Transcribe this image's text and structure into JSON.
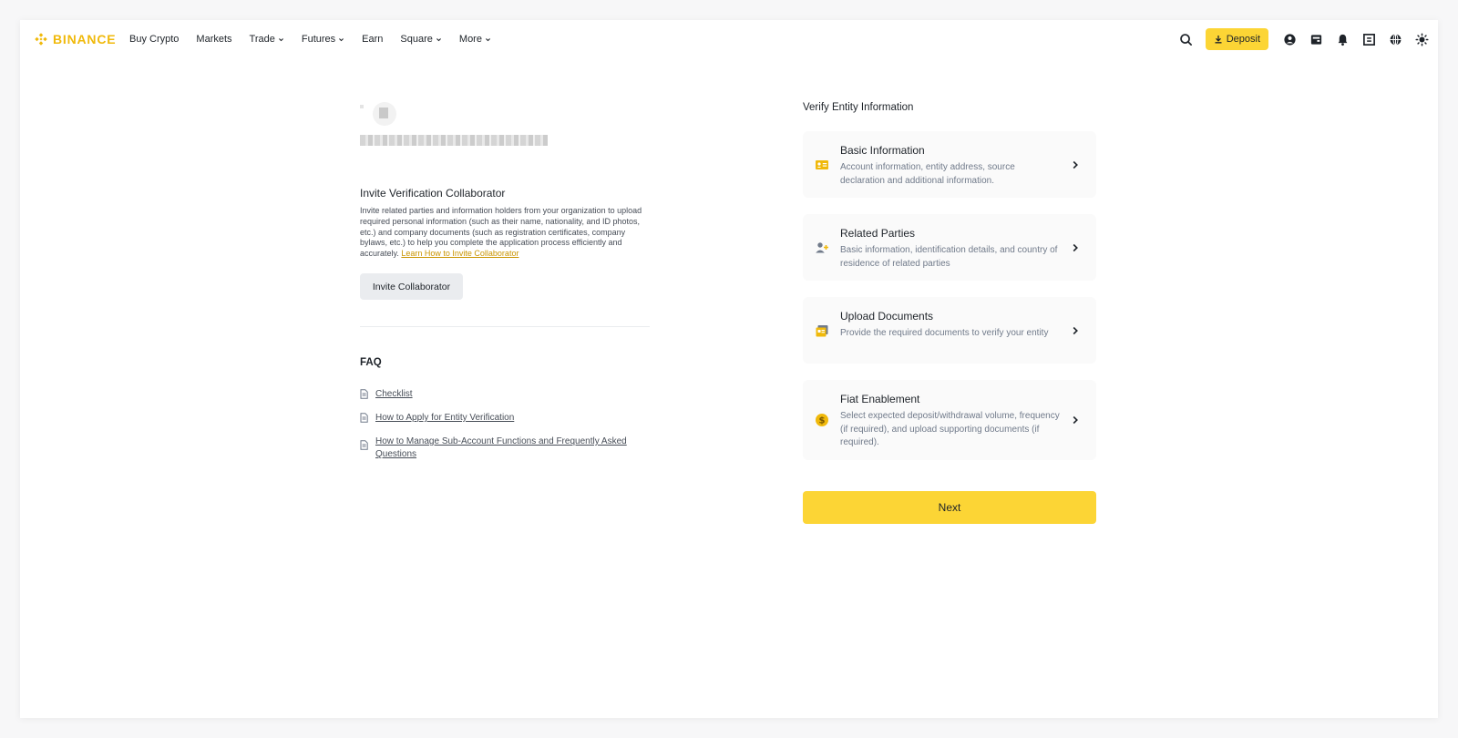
{
  "header": {
    "brand": "BINANCE",
    "nav": [
      {
        "label": "Buy Crypto",
        "dropdown": false
      },
      {
        "label": "Markets",
        "dropdown": false
      },
      {
        "label": "Trade",
        "dropdown": true
      },
      {
        "label": "Futures",
        "dropdown": true
      },
      {
        "label": "Earn",
        "dropdown": false
      },
      {
        "label": "Square",
        "dropdown": true
      },
      {
        "label": "More",
        "dropdown": true
      }
    ],
    "deposit_label": "Deposit",
    "icons": [
      "search-icon",
      "download-icon",
      "user-icon",
      "wallet-icon",
      "bell-icon",
      "qr-icon",
      "globe-icon",
      "theme-icon"
    ]
  },
  "left": {
    "invite_title": "Invite Verification Collaborator",
    "invite_desc": "Invite related parties and information holders from your organization to upload required personal information (such as their name, nationality, and ID photos, etc.) and company documents (such as registration certificates, company bylaws, etc.) to help you complete the application process efficiently and accurately.",
    "invite_link": "Learn How to Invite Collaborator",
    "invite_button": "Invite Collaborator",
    "faq_title": "FAQ",
    "faq_items": [
      "Checklist",
      "How to Apply for Entity Verification",
      "How to Manage Sub-Account Functions and Frequently Asked Questions"
    ]
  },
  "right": {
    "title": "Verify Entity Information",
    "cards": [
      {
        "title": "Basic Information",
        "desc": "Account information, entity address, source declaration and additional information.",
        "icon": "id-card-icon"
      },
      {
        "title": "Related Parties",
        "desc": "Basic information, identification details, and country of residence of related parties",
        "icon": "add-user-icon"
      },
      {
        "title": "Upload Documents",
        "desc": "Provide the required documents to verify your entity",
        "icon": "documents-icon"
      },
      {
        "title": "Fiat Enablement",
        "desc": "Select expected deposit/withdrawal volume, frequency (if required), and upload supporting documents (if required).",
        "icon": "dollar-coin-icon"
      }
    ],
    "next_button": "Next"
  },
  "colors": {
    "brand_yellow": "#f0b90b",
    "button_yellow": "#fcd535",
    "link_gold": "#c99400",
    "text_primary": "#1e2329",
    "text_secondary": "#707a8a"
  }
}
